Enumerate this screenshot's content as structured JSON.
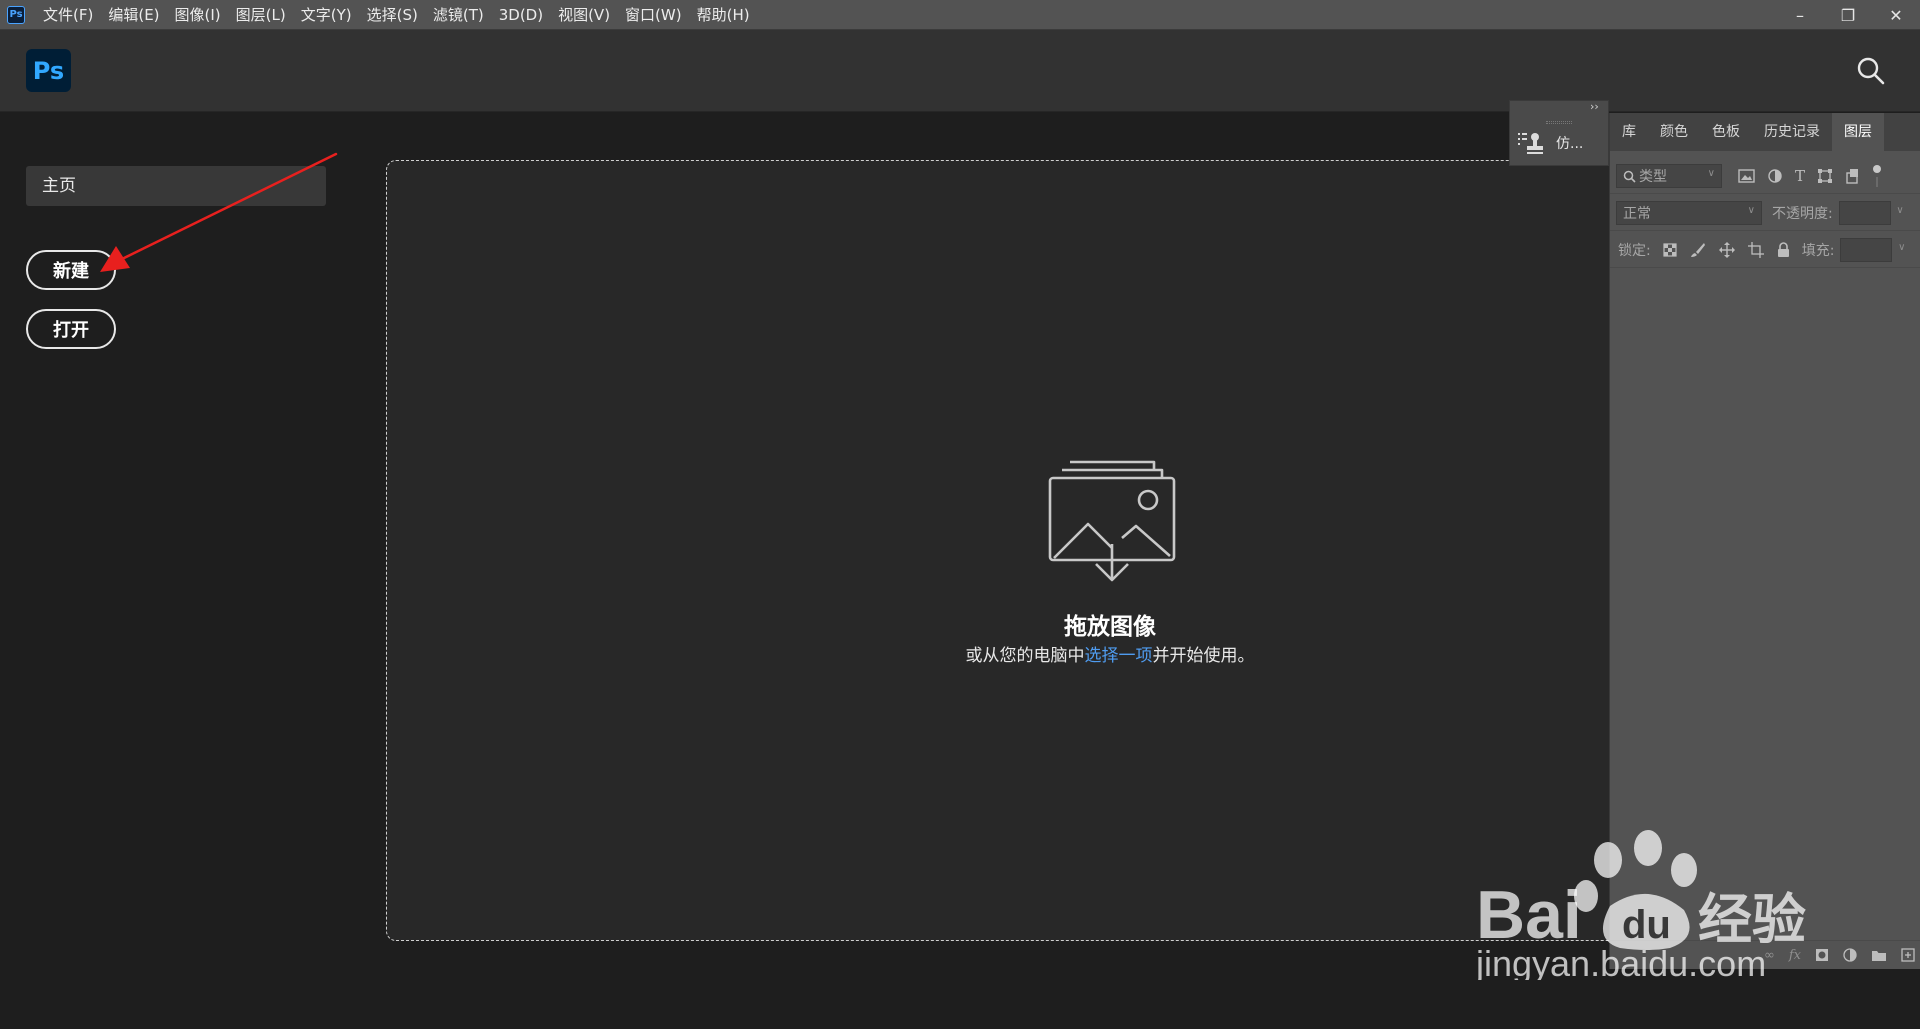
{
  "menubar": {
    "app_badge": "Ps",
    "items": [
      "文件(F)",
      "编辑(E)",
      "图像(I)",
      "图层(L)",
      "文字(Y)",
      "选择(S)",
      "滤镜(T)",
      "3D(D)",
      "视图(V)",
      "窗口(W)",
      "帮助(H)"
    ],
    "window_controls": {
      "minimize": "–",
      "restore": "❐",
      "close": "✕"
    }
  },
  "header": {
    "logo_text": "Ps"
  },
  "sidebar": {
    "home_label": "主页",
    "new_label": "新建",
    "open_label": "打开"
  },
  "dropzone": {
    "title": "拖放图像",
    "subtitle_before": "或从您的电脑中",
    "subtitle_link": "选择一项",
    "subtitle_after": "并开始使用。"
  },
  "mini_panel": {
    "item_label": "仿..."
  },
  "layers_panel": {
    "tabs": [
      "库",
      "颜色",
      "色板",
      "历史记录",
      "图层"
    ],
    "active_tab": "图层",
    "filter_placeholder": "类型",
    "blend_mode": "正常",
    "opacity_label": "不透明度:",
    "lock_label": "锁定:",
    "fill_label": "填充:"
  },
  "watermark": {
    "brand": "Bai",
    "brand_du": "du",
    "suffix": "经验",
    "url": "jingyan.baidu.com"
  },
  "colors": {
    "menubar_bg": "#535353",
    "header_bg": "#323232",
    "canvas_bg": "#1e1e1e",
    "dropzone_bg": "#282828",
    "link_blue": "#4f9cf0",
    "ps_blue": "#31a8ff",
    "arrow_red": "#e8201e"
  }
}
